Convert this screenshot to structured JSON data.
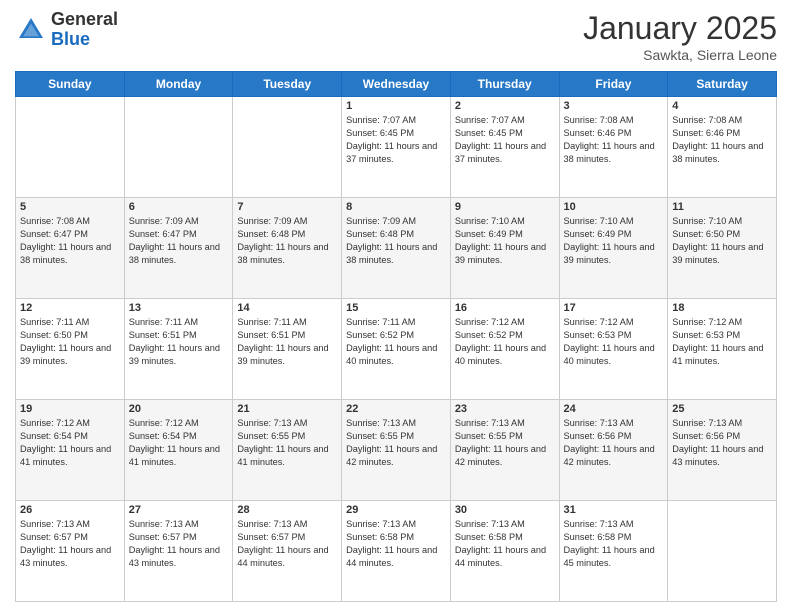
{
  "header": {
    "logo_general": "General",
    "logo_blue": "Blue",
    "title": "January 2025",
    "location": "Sawkta, Sierra Leone"
  },
  "weekdays": [
    "Sunday",
    "Monday",
    "Tuesday",
    "Wednesday",
    "Thursday",
    "Friday",
    "Saturday"
  ],
  "weeks": [
    [
      {
        "day": "",
        "info": ""
      },
      {
        "day": "",
        "info": ""
      },
      {
        "day": "",
        "info": ""
      },
      {
        "day": "1",
        "info": "Sunrise: 7:07 AM\nSunset: 6:45 PM\nDaylight: 11 hours and 37 minutes."
      },
      {
        "day": "2",
        "info": "Sunrise: 7:07 AM\nSunset: 6:45 PM\nDaylight: 11 hours and 37 minutes."
      },
      {
        "day": "3",
        "info": "Sunrise: 7:08 AM\nSunset: 6:46 PM\nDaylight: 11 hours and 38 minutes."
      },
      {
        "day": "4",
        "info": "Sunrise: 7:08 AM\nSunset: 6:46 PM\nDaylight: 11 hours and 38 minutes."
      }
    ],
    [
      {
        "day": "5",
        "info": "Sunrise: 7:08 AM\nSunset: 6:47 PM\nDaylight: 11 hours and 38 minutes."
      },
      {
        "day": "6",
        "info": "Sunrise: 7:09 AM\nSunset: 6:47 PM\nDaylight: 11 hours and 38 minutes."
      },
      {
        "day": "7",
        "info": "Sunrise: 7:09 AM\nSunset: 6:48 PM\nDaylight: 11 hours and 38 minutes."
      },
      {
        "day": "8",
        "info": "Sunrise: 7:09 AM\nSunset: 6:48 PM\nDaylight: 11 hours and 38 minutes."
      },
      {
        "day": "9",
        "info": "Sunrise: 7:10 AM\nSunset: 6:49 PM\nDaylight: 11 hours and 39 minutes."
      },
      {
        "day": "10",
        "info": "Sunrise: 7:10 AM\nSunset: 6:49 PM\nDaylight: 11 hours and 39 minutes."
      },
      {
        "day": "11",
        "info": "Sunrise: 7:10 AM\nSunset: 6:50 PM\nDaylight: 11 hours and 39 minutes."
      }
    ],
    [
      {
        "day": "12",
        "info": "Sunrise: 7:11 AM\nSunset: 6:50 PM\nDaylight: 11 hours and 39 minutes."
      },
      {
        "day": "13",
        "info": "Sunrise: 7:11 AM\nSunset: 6:51 PM\nDaylight: 11 hours and 39 minutes."
      },
      {
        "day": "14",
        "info": "Sunrise: 7:11 AM\nSunset: 6:51 PM\nDaylight: 11 hours and 39 minutes."
      },
      {
        "day": "15",
        "info": "Sunrise: 7:11 AM\nSunset: 6:52 PM\nDaylight: 11 hours and 40 minutes."
      },
      {
        "day": "16",
        "info": "Sunrise: 7:12 AM\nSunset: 6:52 PM\nDaylight: 11 hours and 40 minutes."
      },
      {
        "day": "17",
        "info": "Sunrise: 7:12 AM\nSunset: 6:53 PM\nDaylight: 11 hours and 40 minutes."
      },
      {
        "day": "18",
        "info": "Sunrise: 7:12 AM\nSunset: 6:53 PM\nDaylight: 11 hours and 41 minutes."
      }
    ],
    [
      {
        "day": "19",
        "info": "Sunrise: 7:12 AM\nSunset: 6:54 PM\nDaylight: 11 hours and 41 minutes."
      },
      {
        "day": "20",
        "info": "Sunrise: 7:12 AM\nSunset: 6:54 PM\nDaylight: 11 hours and 41 minutes."
      },
      {
        "day": "21",
        "info": "Sunrise: 7:13 AM\nSunset: 6:55 PM\nDaylight: 11 hours and 41 minutes."
      },
      {
        "day": "22",
        "info": "Sunrise: 7:13 AM\nSunset: 6:55 PM\nDaylight: 11 hours and 42 minutes."
      },
      {
        "day": "23",
        "info": "Sunrise: 7:13 AM\nSunset: 6:55 PM\nDaylight: 11 hours and 42 minutes."
      },
      {
        "day": "24",
        "info": "Sunrise: 7:13 AM\nSunset: 6:56 PM\nDaylight: 11 hours and 42 minutes."
      },
      {
        "day": "25",
        "info": "Sunrise: 7:13 AM\nSunset: 6:56 PM\nDaylight: 11 hours and 43 minutes."
      }
    ],
    [
      {
        "day": "26",
        "info": "Sunrise: 7:13 AM\nSunset: 6:57 PM\nDaylight: 11 hours and 43 minutes."
      },
      {
        "day": "27",
        "info": "Sunrise: 7:13 AM\nSunset: 6:57 PM\nDaylight: 11 hours and 43 minutes."
      },
      {
        "day": "28",
        "info": "Sunrise: 7:13 AM\nSunset: 6:57 PM\nDaylight: 11 hours and 44 minutes."
      },
      {
        "day": "29",
        "info": "Sunrise: 7:13 AM\nSunset: 6:58 PM\nDaylight: 11 hours and 44 minutes."
      },
      {
        "day": "30",
        "info": "Sunrise: 7:13 AM\nSunset: 6:58 PM\nDaylight: 11 hours and 44 minutes."
      },
      {
        "day": "31",
        "info": "Sunrise: 7:13 AM\nSunset: 6:58 PM\nDaylight: 11 hours and 45 minutes."
      },
      {
        "day": "",
        "info": ""
      }
    ]
  ]
}
